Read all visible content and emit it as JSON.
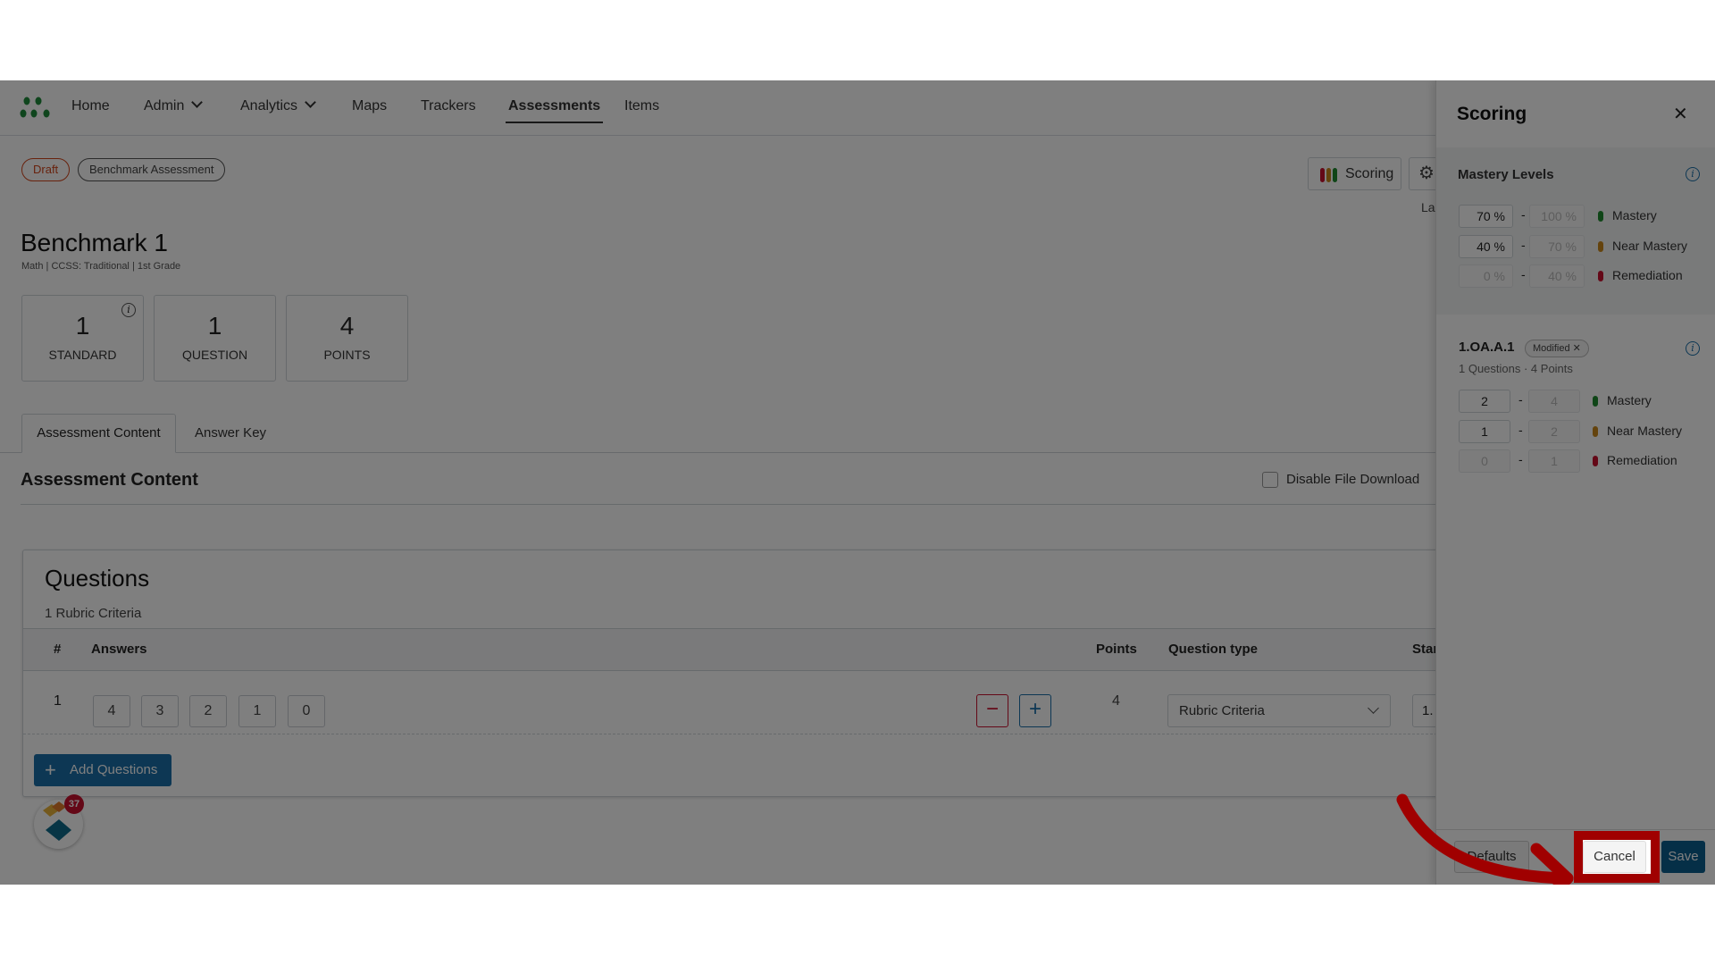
{
  "nav": {
    "items": [
      {
        "label": "Home"
      },
      {
        "label": "Admin",
        "dropdown": true
      },
      {
        "label": "Analytics",
        "dropdown": true
      },
      {
        "label": "Maps"
      },
      {
        "label": "Trackers"
      },
      {
        "label": "Assessments",
        "active": true
      },
      {
        "label": "Items"
      }
    ]
  },
  "badges": {
    "status": "Draft",
    "type": "Benchmark Assessment"
  },
  "toolbar": {
    "scoring_label": "Scoring",
    "truncated_text": "La"
  },
  "assessment": {
    "title": "Benchmark 1",
    "subject": "Math",
    "framework": "CCSS: Traditional",
    "grade": "1st Grade",
    "separator": "|"
  },
  "stats": [
    {
      "value": "1",
      "label": "STANDARD"
    },
    {
      "value": "1",
      "label": "QUESTION"
    },
    {
      "value": "4",
      "label": "POINTS"
    }
  ],
  "tabs": [
    {
      "label": "Assessment Content",
      "active": true
    },
    {
      "label": "Answer Key"
    }
  ],
  "content": {
    "heading": "Assessment Content",
    "disable_download_label": "Disable File Download",
    "disable_download_checked": false
  },
  "questions": {
    "title": "Questions",
    "subtitle": "1 Rubric Criteria",
    "columns": {
      "num": "#",
      "answers": "Answers",
      "points": "Points",
      "type": "Question type",
      "standard": "Star"
    },
    "rows": [
      {
        "num": "1",
        "answers": [
          "4",
          "3",
          "2",
          "1",
          "0"
        ],
        "points": "4",
        "type": "Rubric Criteria",
        "standard": "1."
      }
    ],
    "add_label": "Add Questions"
  },
  "widget": {
    "notification_count": "37"
  },
  "scoring_panel": {
    "title": "Scoring",
    "mastery": {
      "heading": "Mastery Levels",
      "rows": [
        {
          "from": "70",
          "to": "100",
          "unit": "%",
          "label": "Mastery",
          "color": "#1e8a2e"
        },
        {
          "from": "40",
          "to": "70",
          "unit": "%",
          "label": "Near Mastery",
          "color": "#c8861a"
        },
        {
          "from": "0",
          "to": "40",
          "unit": "%",
          "label": "Remediation",
          "color": "#c8102e"
        }
      ]
    },
    "standard": {
      "code": "1.OA.A.1",
      "badge": "Modified",
      "summary": "1 Questions · 4 Points",
      "rows": [
        {
          "from": "2",
          "to": "4",
          "label": "Mastery",
          "color": "#1e8a2e"
        },
        {
          "from": "1",
          "to": "2",
          "label": "Near Mastery",
          "color": "#c8861a"
        },
        {
          "from": "0",
          "to": "1",
          "label": "Remediation",
          "color": "#c8102e"
        }
      ]
    },
    "footer": {
      "defaults": "Defaults",
      "cancel": "Cancel",
      "save": "Save"
    }
  },
  "colors": {
    "accent": "#1a6fa8",
    "annotation": "#a00000",
    "draft": "#d0451b"
  }
}
